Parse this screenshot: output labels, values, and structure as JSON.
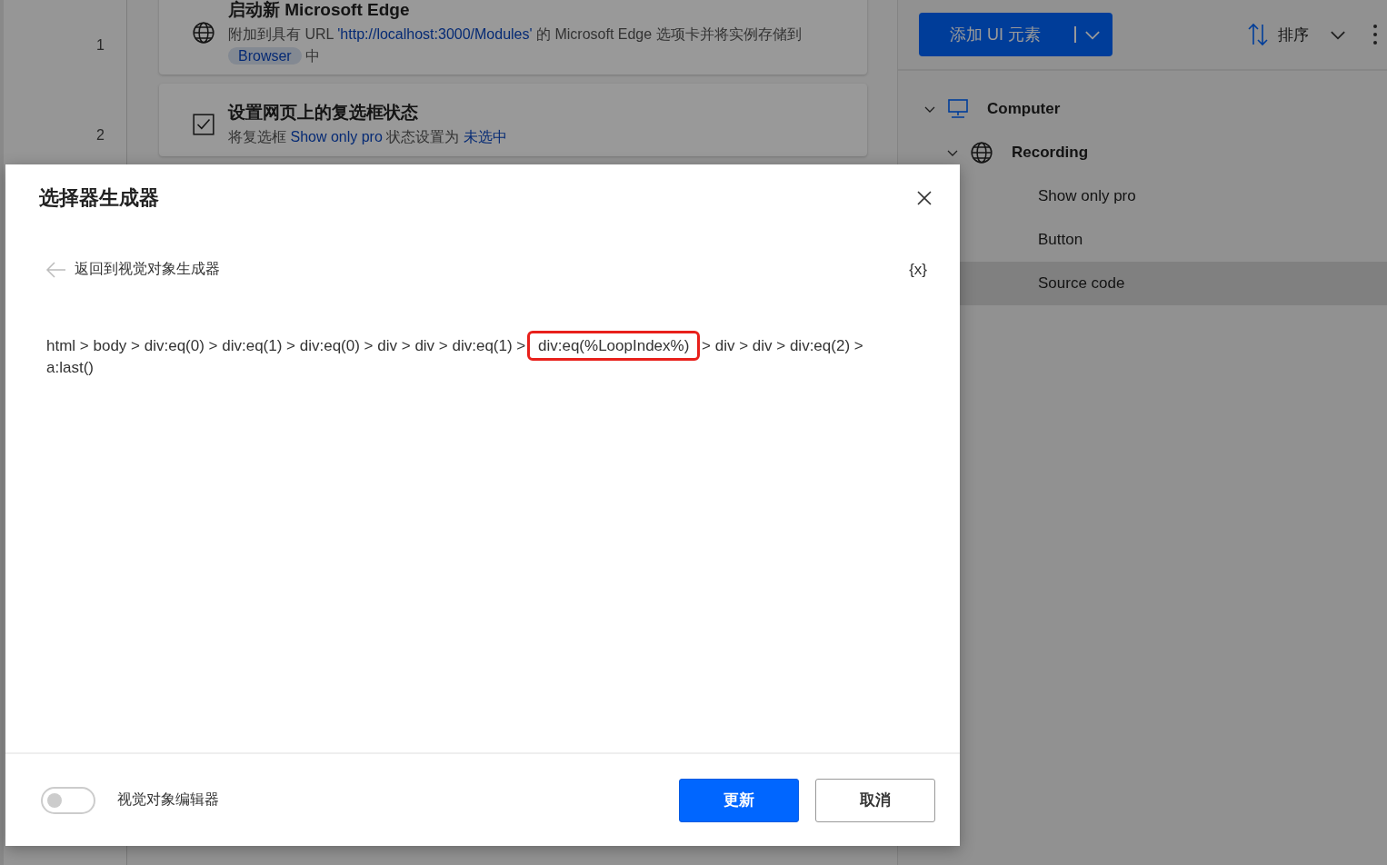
{
  "flow": {
    "steps": [
      {
        "number": "1",
        "kind": "browser",
        "title": "启动新 Microsoft Edge",
        "description": [
          {
            "kind": "text",
            "text": "附加到具有 URL "
          },
          {
            "kind": "value",
            "text": "'http://localhost:3000/Modules'"
          },
          {
            "kind": "text",
            "text": " 的 Microsoft Edge 选项卡并将实例存储到 "
          },
          {
            "kind": "variable",
            "text": "Browser"
          },
          {
            "kind": "text",
            "text": " 中"
          }
        ]
      },
      {
        "number": "2",
        "kind": "checkbox",
        "title": "设置网页上的复选框状态",
        "description": [
          {
            "kind": "text",
            "text": "将复选框 "
          },
          {
            "kind": "value",
            "text": "Show only pro"
          },
          {
            "kind": "text",
            "text": " 状态设置为 "
          },
          {
            "kind": "value",
            "text": "未选中"
          }
        ]
      }
    ]
  },
  "ui_elements_panel": {
    "add_button": "添加 UI 元素",
    "sort_label": "排序",
    "tree": [
      {
        "label": "Computer",
        "kind": "computer",
        "expanded": true,
        "selected": false,
        "children": [
          {
            "label": "Recording",
            "kind": "browser",
            "expanded": true,
            "selected": false,
            "children": [
              {
                "label": "Show only pro",
                "selected": false
              },
              {
                "label": "Button",
                "selected": false
              },
              {
                "label": "Source code",
                "selected": true
              }
            ]
          }
        ]
      }
    ]
  },
  "dialog": {
    "title": "选择器生成器",
    "back_label": "返回到视觉对象生成器",
    "variable_button": "{x}",
    "selector": [
      {
        "text": "html > body > div:eq(0) > div:eq(1) > div:eq(0) > div > div > div:eq(1) > ",
        "highlighted": false
      },
      {
        "text": "div:eq(%LoopIndex%)",
        "highlighted": true
      },
      {
        "text": " > div > div > div:eq(2) > a:last()",
        "highlighted": false
      }
    ],
    "visual_editor": {
      "label": "视觉对象编辑器",
      "on": false
    },
    "buttons": [
      {
        "label": "更新",
        "kind": "primary"
      },
      {
        "label": "取消",
        "kind": "secondary"
      }
    ]
  }
}
